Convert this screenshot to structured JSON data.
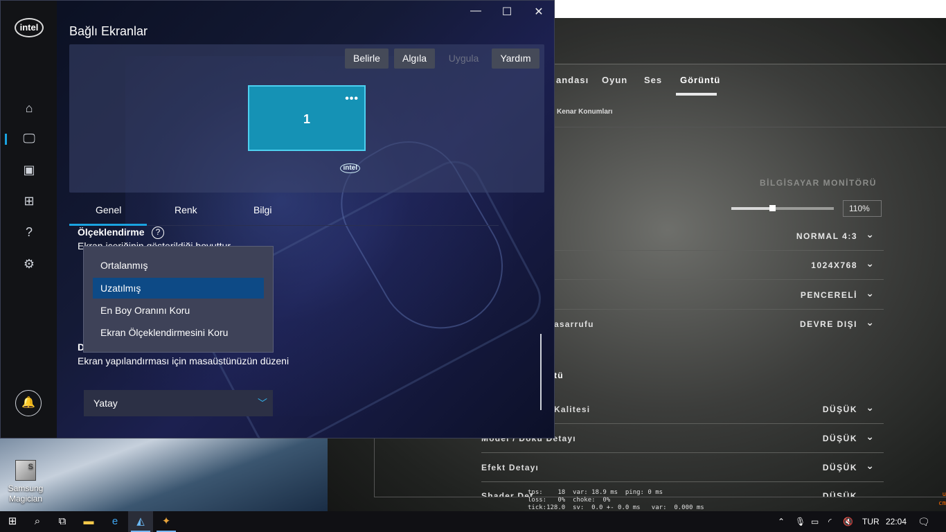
{
  "desktop": {
    "icon_label": "Samsung Magician",
    "icon_glyph": "S"
  },
  "game": {
    "tabs": [
      "andası",
      "Oyun",
      "Ses",
      "Görüntü"
    ],
    "subnav": "Kenar Konumları",
    "monitor_header": "BİLGİSAYAR MONİTÖRÜ",
    "brightness_pct": "110%",
    "brightness_level": 0.4,
    "rows": [
      {
        "label": "",
        "value": "NORMAL 4:3"
      },
      {
        "label": "",
        "value": "1024X768"
      },
      {
        "label": "",
        "value": "PENCERELİ"
      },
      {
        "label": "asarrufu",
        "value": "DEVRE DIŞI"
      }
    ],
    "section2": "tü",
    "rows2": [
      {
        "label": "Kalitesi",
        "value": "DÜŞÜK"
      },
      {
        "label": "Model / Doku Detayı",
        "value": "DÜŞÜK"
      },
      {
        "label": "Efekt Detayı",
        "value": "DÜŞÜK"
      },
      {
        "label": "Shader Det",
        "value": "DÜŞÜK"
      }
    ],
    "console": "tps:    18  var: 18.9 ms  ping: 0 ms\nloss:   0%  choke:  0%\ntick:128.0  sv:  0.0 +- 0.0 ms   var:  0.000 ms",
    "red_text": "u\ncm"
  },
  "intel": {
    "logo": "intel",
    "title": "Bağlı Ekranlar",
    "buttons": {
      "identify": "Belirle",
      "detect": "Algıla",
      "apply": "Uygula",
      "help": "Yardım"
    },
    "monitor": {
      "number": "1",
      "dots": "•••",
      "logo": "intel"
    },
    "tabs": [
      "Genel",
      "Renk",
      "Bilgi"
    ],
    "scaling": {
      "title": "Ölçeklendirme",
      "desc": "Ekran içeriğinin gösterildiği boyuttur"
    },
    "dropdown_options": [
      "Ortalanmış",
      "Uzatılmış",
      "En Boy Oranını Koru",
      "Ekran Ölçeklendirmesini Koru"
    ],
    "selected_option": "Uzatılmış",
    "orientation": {
      "title_fragment": "D",
      "desc": "Ekran yapılandırması için masaüstünüzün düzeni",
      "value": "Yatay"
    },
    "icons": [
      "home-icon",
      "display-icon",
      "video-icon",
      "apps-icon",
      "help-icon",
      "settings-icon",
      "bell-icon"
    ]
  },
  "taskbar": {
    "lang": "TUR",
    "time": "22:04"
  }
}
